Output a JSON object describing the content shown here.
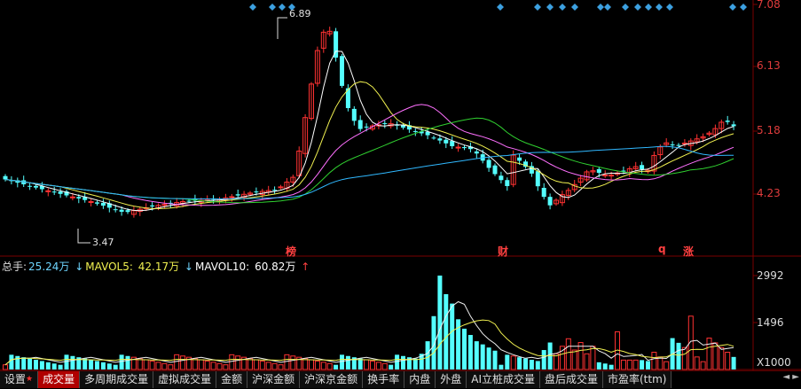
{
  "price_axis": [
    "7.08",
    "6.13",
    "5.18",
    "4.23"
  ],
  "volume_axis": [
    "2992",
    "1496",
    "X1000"
  ],
  "annotations": {
    "high": "6.89",
    "low": "3.47"
  },
  "markers": [
    {
      "text": "榜",
      "color": "#ff4040"
    },
    {
      "text": "财",
      "color": "#ff4040"
    },
    {
      "text": "q",
      "color": "#ff4040"
    },
    {
      "text": "涨",
      "color": "#ff4040"
    }
  ],
  "volume_info": {
    "total_label": "总手:",
    "total_value": "25.24万",
    "mavol5_label": "MAVOL5:",
    "mavol5_value": "42.17万",
    "mavol10_label": "MAVOL10:",
    "mavol10_value": "60.82万",
    "arrow_down": "↓",
    "arrow_up": "↑"
  },
  "tabs": [
    {
      "label": "设置",
      "has_star": true
    },
    {
      "label": "成交量",
      "active": true
    },
    {
      "label": "多周期成交量"
    },
    {
      "label": "虚拟成交量"
    },
    {
      "label": "金额"
    },
    {
      "label": "沪深金额"
    },
    {
      "label": "沪深京金额"
    },
    {
      "label": "换手率"
    },
    {
      "label": "内盘"
    },
    {
      "label": "外盘"
    },
    {
      "label": "AI立桩成交量"
    },
    {
      "label": "盘后成交量"
    },
    {
      "label": "市盈率(ttm)"
    }
  ],
  "scroll_arrows": "◄ ►",
  "colors": {
    "up": "#ff3232",
    "down": "#54ffff",
    "ma5": "#ffffff",
    "ma10": "#f0f050",
    "ma20": "#ff70ff",
    "ma30": "#30d030",
    "ma60": "#30b8ff",
    "grid": "#7a0000"
  }
}
